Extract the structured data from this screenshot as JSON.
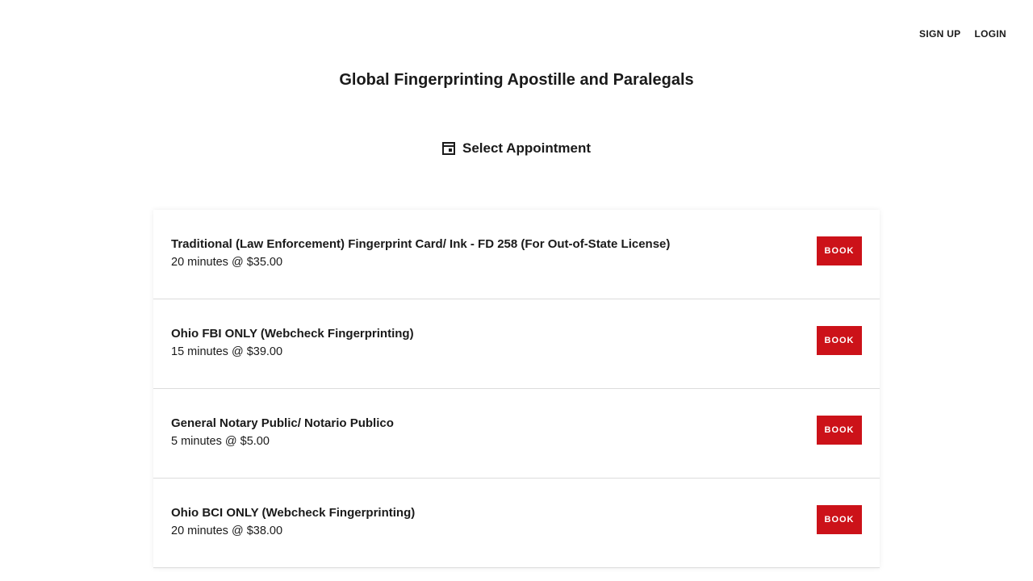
{
  "nav": {
    "signup_label": "SIGN UP",
    "login_label": "LOGIN"
  },
  "business": {
    "title": "Global Fingerprinting Apostille and Paralegals"
  },
  "section": {
    "icon": "calendar-icon",
    "heading": "Select Appointment"
  },
  "appointments": [
    {
      "name": "Traditional (Law Enforcement) Fingerprint Card/ Ink - FD 258 (For Out-of-State License)",
      "details": "20 minutes @ $35.00",
      "button_label": "BOOK"
    },
    {
      "name": "Ohio FBI ONLY (Webcheck Fingerprinting)",
      "details": "15 minutes @ $39.00",
      "button_label": "BOOK"
    },
    {
      "name": "General Notary Public/ Notario Publico",
      "details": "5 minutes @ $5.00",
      "button_label": "BOOK"
    },
    {
      "name": "Ohio BCI ONLY (Webcheck Fingerprinting)",
      "details": "20 minutes @ $38.00",
      "button_label": "BOOK"
    }
  ],
  "colors": {
    "accent": "#cc1219",
    "text": "#1a1a1a",
    "divider": "#dcdcdc"
  }
}
